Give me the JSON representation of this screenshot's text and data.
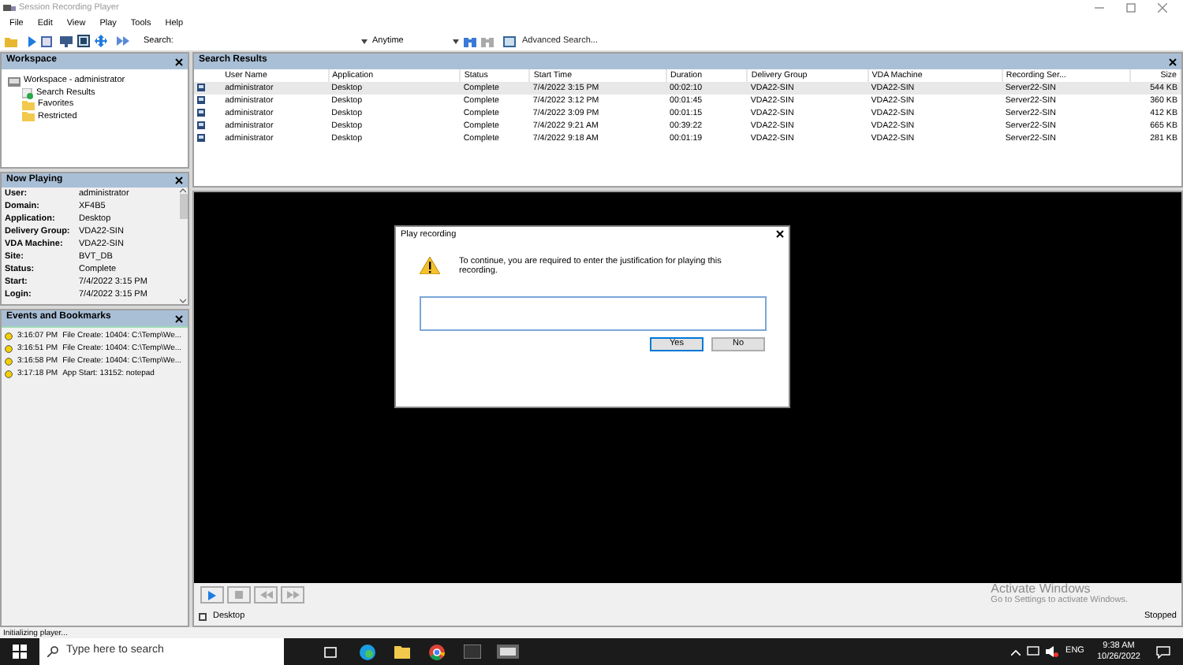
{
  "window": {
    "title": "Session Recording Player"
  },
  "menu": [
    "File",
    "Edit",
    "View",
    "Play",
    "Tools",
    "Help"
  ],
  "toolbar": {
    "search_label": "Search:",
    "date_filter": "Anytime",
    "advanced_search": "Advanced Search..."
  },
  "workspace": {
    "title": "Workspace",
    "tree": [
      {
        "label": "Workspace - administrator",
        "children": [
          {
            "label": "Search Results",
            "kind": "search"
          },
          {
            "label": "Favorites",
            "kind": "folder"
          },
          {
            "label": "Restricted",
            "kind": "folder"
          }
        ]
      }
    ]
  },
  "now_playing": {
    "title": "Now Playing",
    "fields": [
      {
        "label": "User:",
        "value": "administrator"
      },
      {
        "label": "Domain:",
        "value": "XF4B5"
      },
      {
        "label": "Application:",
        "value": "Desktop"
      },
      {
        "label": "Delivery Group:",
        "value": "VDA22-SIN"
      },
      {
        "label": "VDA Machine:",
        "value": "VDA22-SIN"
      },
      {
        "label": "Site:",
        "value": "BVT_DB"
      },
      {
        "label": "Status:",
        "value": "Complete"
      },
      {
        "label": "Start:",
        "value": "7/4/2022 3:15 PM"
      },
      {
        "label": "Login:",
        "value": "7/4/2022 3:15 PM"
      }
    ]
  },
  "events": {
    "title": "Events and Bookmarks",
    "items": [
      {
        "time": "3:16:07 PM",
        "text": "File Create: 10404: C:\\Temp\\We..."
      },
      {
        "time": "3:16:51 PM",
        "text": "File Create: 10404: C:\\Temp\\We..."
      },
      {
        "time": "3:16:58 PM",
        "text": "File Create: 10404: C:\\Temp\\We..."
      },
      {
        "time": "3:17:18 PM",
        "text": "App Start: 13152: notepad"
      }
    ]
  },
  "search_results": {
    "title": "Search Results",
    "columns": [
      "User Name",
      "Application",
      "Status",
      "Start Time",
      "Duration",
      "Delivery Group",
      "VDA Machine",
      "Recording Ser...",
      "Size"
    ],
    "rows": [
      {
        "selected": true,
        "cells": [
          "administrator",
          "Desktop",
          "Complete",
          "7/4/2022 3:15 PM",
          "00:02:10",
          "VDA22-SIN",
          "VDA22-SIN",
          "Server22-SIN",
          "544 KB"
        ]
      },
      {
        "selected": false,
        "cells": [
          "administrator",
          "Desktop",
          "Complete",
          "7/4/2022 3:12 PM",
          "00:01:45",
          "VDA22-SIN",
          "VDA22-SIN",
          "Server22-SIN",
          "360 KB"
        ]
      },
      {
        "selected": false,
        "cells": [
          "administrator",
          "Desktop",
          "Complete",
          "7/4/2022 3:09 PM",
          "00:01:15",
          "VDA22-SIN",
          "VDA22-SIN",
          "Server22-SIN",
          "412 KB"
        ]
      },
      {
        "selected": false,
        "cells": [
          "administrator",
          "Desktop",
          "Complete",
          "7/4/2022 9:21 AM",
          "00:39:22",
          "VDA22-SIN",
          "VDA22-SIN",
          "Server22-SIN",
          "665 KB"
        ]
      },
      {
        "selected": false,
        "cells": [
          "administrator",
          "Desktop",
          "Complete",
          "7/4/2022 9:18 AM",
          "00:01:19",
          "VDA22-SIN",
          "VDA22-SIN",
          "Server22-SIN",
          "281 KB"
        ]
      }
    ]
  },
  "dialog": {
    "title": "Play recording",
    "message": "To continue, you are required to enter the justification for playing this recording.",
    "buttons": [
      {
        "label": "Yes",
        "default": true
      },
      {
        "label": "No",
        "default": false
      }
    ]
  },
  "player": {
    "session_label": "Desktop",
    "session_checked": false,
    "state": "Stopped"
  },
  "watermark": {
    "title": "Activate Windows",
    "subtitle": "Go to Settings to activate Windows."
  },
  "status_bar": "Initializing player...",
  "taskbar": {
    "search_placeholder": "Type here to search",
    "language": "ENG",
    "time": "9:38 AM",
    "date": "10/26/2022"
  }
}
